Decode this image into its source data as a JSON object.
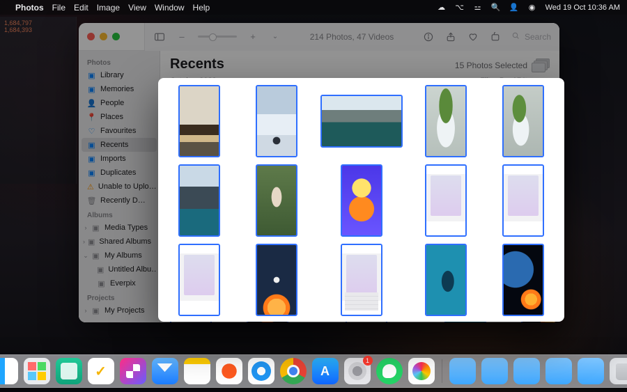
{
  "menubar": {
    "apple": "",
    "app": "Photos",
    "menus": [
      "File",
      "Edit",
      "Image",
      "View",
      "Window",
      "Help"
    ],
    "status_icons": [
      "cloud-icon",
      "control-center-icon",
      "wifi-icon",
      "spotlight-icon",
      "users-icon",
      "siri-icon"
    ],
    "datetime": "Wed 19 Oct  10:36 AM"
  },
  "toolbar": {
    "counts": "214 Photos, 47 Videos",
    "search_placeholder": "Search"
  },
  "sidebar": {
    "sections": {
      "photos": {
        "label": "Photos",
        "items": [
          {
            "icon": "photo-icon",
            "label": "Library"
          },
          {
            "icon": "clock-icon",
            "label": "Memories"
          },
          {
            "icon": "person-icon",
            "label": "People"
          },
          {
            "icon": "pin-icon",
            "label": "Places"
          },
          {
            "icon": "heart-icon",
            "label": "Favourites"
          },
          {
            "icon": "clock-icon",
            "label": "Recents",
            "active": true
          },
          {
            "icon": "tray-icon",
            "label": "Imports"
          },
          {
            "icon": "square-on-square-icon",
            "label": "Duplicates"
          },
          {
            "icon": "warning-icon",
            "label": "Unable to Uplo…",
            "warn": true
          },
          {
            "icon": "trash-icon",
            "label": "Recently D…",
            "gray": true
          }
        ]
      },
      "albums": {
        "label": "Albums",
        "items": [
          {
            "chev": "›",
            "icon": "folder-icon",
            "label": "Media Types",
            "gray": true
          },
          {
            "chev": "›",
            "icon": "folder-icon",
            "label": "Shared Albums",
            "gray": true
          },
          {
            "chev": "⌄",
            "icon": "folder-icon",
            "label": "My Albums",
            "gray": true
          },
          {
            "indent": true,
            "icon": "rectangle-icon",
            "label": "Untitled Albu…",
            "gray": true
          },
          {
            "indent": true,
            "icon": "rectangle-icon",
            "label": "Everpix",
            "gray": true
          }
        ]
      },
      "projects": {
        "label": "Projects",
        "items": [
          {
            "chev": "›",
            "icon": "folder-icon",
            "label": "My Projects",
            "gray": true
          }
        ]
      }
    }
  },
  "main": {
    "title": "Recents",
    "selection": "15 Photos Selected",
    "date_section": "October 2022",
    "filter_label": "Filter By: All Items"
  },
  "panel": {
    "thumbs": [
      {
        "name": "photo-autumn-valley",
        "art": "art-autumn",
        "wide": false
      },
      {
        "name": "photo-snowy-road",
        "art": "art-snowroad",
        "wide": false
      },
      {
        "name": "photo-mountain-lake",
        "art": "art-mtnlake",
        "wide": true
      },
      {
        "name": "photo-potted-plant-1",
        "art": "art-plant",
        "wide": false
      },
      {
        "name": "photo-potted-plant-2",
        "art": "art-plant2",
        "wide": false
      },
      {
        "name": "photo-mountain-lake-2",
        "art": "art-mtn2",
        "wide": false
      },
      {
        "name": "photo-dog",
        "art": "art-dog",
        "wide": false
      },
      {
        "name": "photo-naruto",
        "art": "art-naruto",
        "wide": false
      },
      {
        "name": "screenshot-phone-plant-1",
        "art": "art-phone",
        "wide": false,
        "phone": true
      },
      {
        "name": "screenshot-phone-plant-2",
        "art": "art-phone",
        "wide": false,
        "phone": true
      },
      {
        "name": "screenshot-phone-chat",
        "art": "art-phone",
        "wide": false,
        "phone": true
      },
      {
        "name": "photo-rocket-launch",
        "art": "art-rocket",
        "wide": false
      },
      {
        "name": "screenshot-phone-keyboard",
        "art": "art-phone",
        "wide": false,
        "phone": true,
        "kbd": true
      },
      {
        "name": "photo-whale",
        "art": "art-whale",
        "wide": false
      },
      {
        "name": "photo-spaceship",
        "art": "art-space",
        "wide": false
      }
    ]
  },
  "dock": {
    "apps": [
      {
        "name": "finder",
        "cls": "finder"
      },
      {
        "name": "launchpad",
        "cls": "launchpad"
      },
      {
        "name": "calculator",
        "cls": "calc"
      },
      {
        "name": "things",
        "cls": "things"
      },
      {
        "name": "shortcuts",
        "cls": "shortcuts"
      },
      {
        "name": "mail",
        "cls": "mail"
      },
      {
        "name": "notes",
        "cls": "notes"
      },
      {
        "name": "brave",
        "cls": "brave"
      },
      {
        "name": "safari",
        "cls": "safari"
      },
      {
        "name": "chrome",
        "cls": "chrome"
      },
      {
        "name": "app-store",
        "cls": "appstore"
      },
      {
        "name": "system-settings",
        "cls": "settings",
        "badge": "1"
      },
      {
        "name": "whatsapp",
        "cls": "whatsapp"
      },
      {
        "name": "photos",
        "cls": "photos"
      }
    ],
    "right": [
      {
        "name": "downloads-folder",
        "cls": "folder"
      },
      {
        "name": "documents-folder",
        "cls": "folder"
      },
      {
        "name": "desktop-folder",
        "cls": "folder"
      },
      {
        "name": "applications-folder",
        "cls": "folder"
      },
      {
        "name": "pictures-folder",
        "cls": "folder"
      },
      {
        "name": "trash",
        "cls": "trash"
      }
    ]
  },
  "codewin_lines": [
    "1,684,797",
    "1,684,393"
  ]
}
